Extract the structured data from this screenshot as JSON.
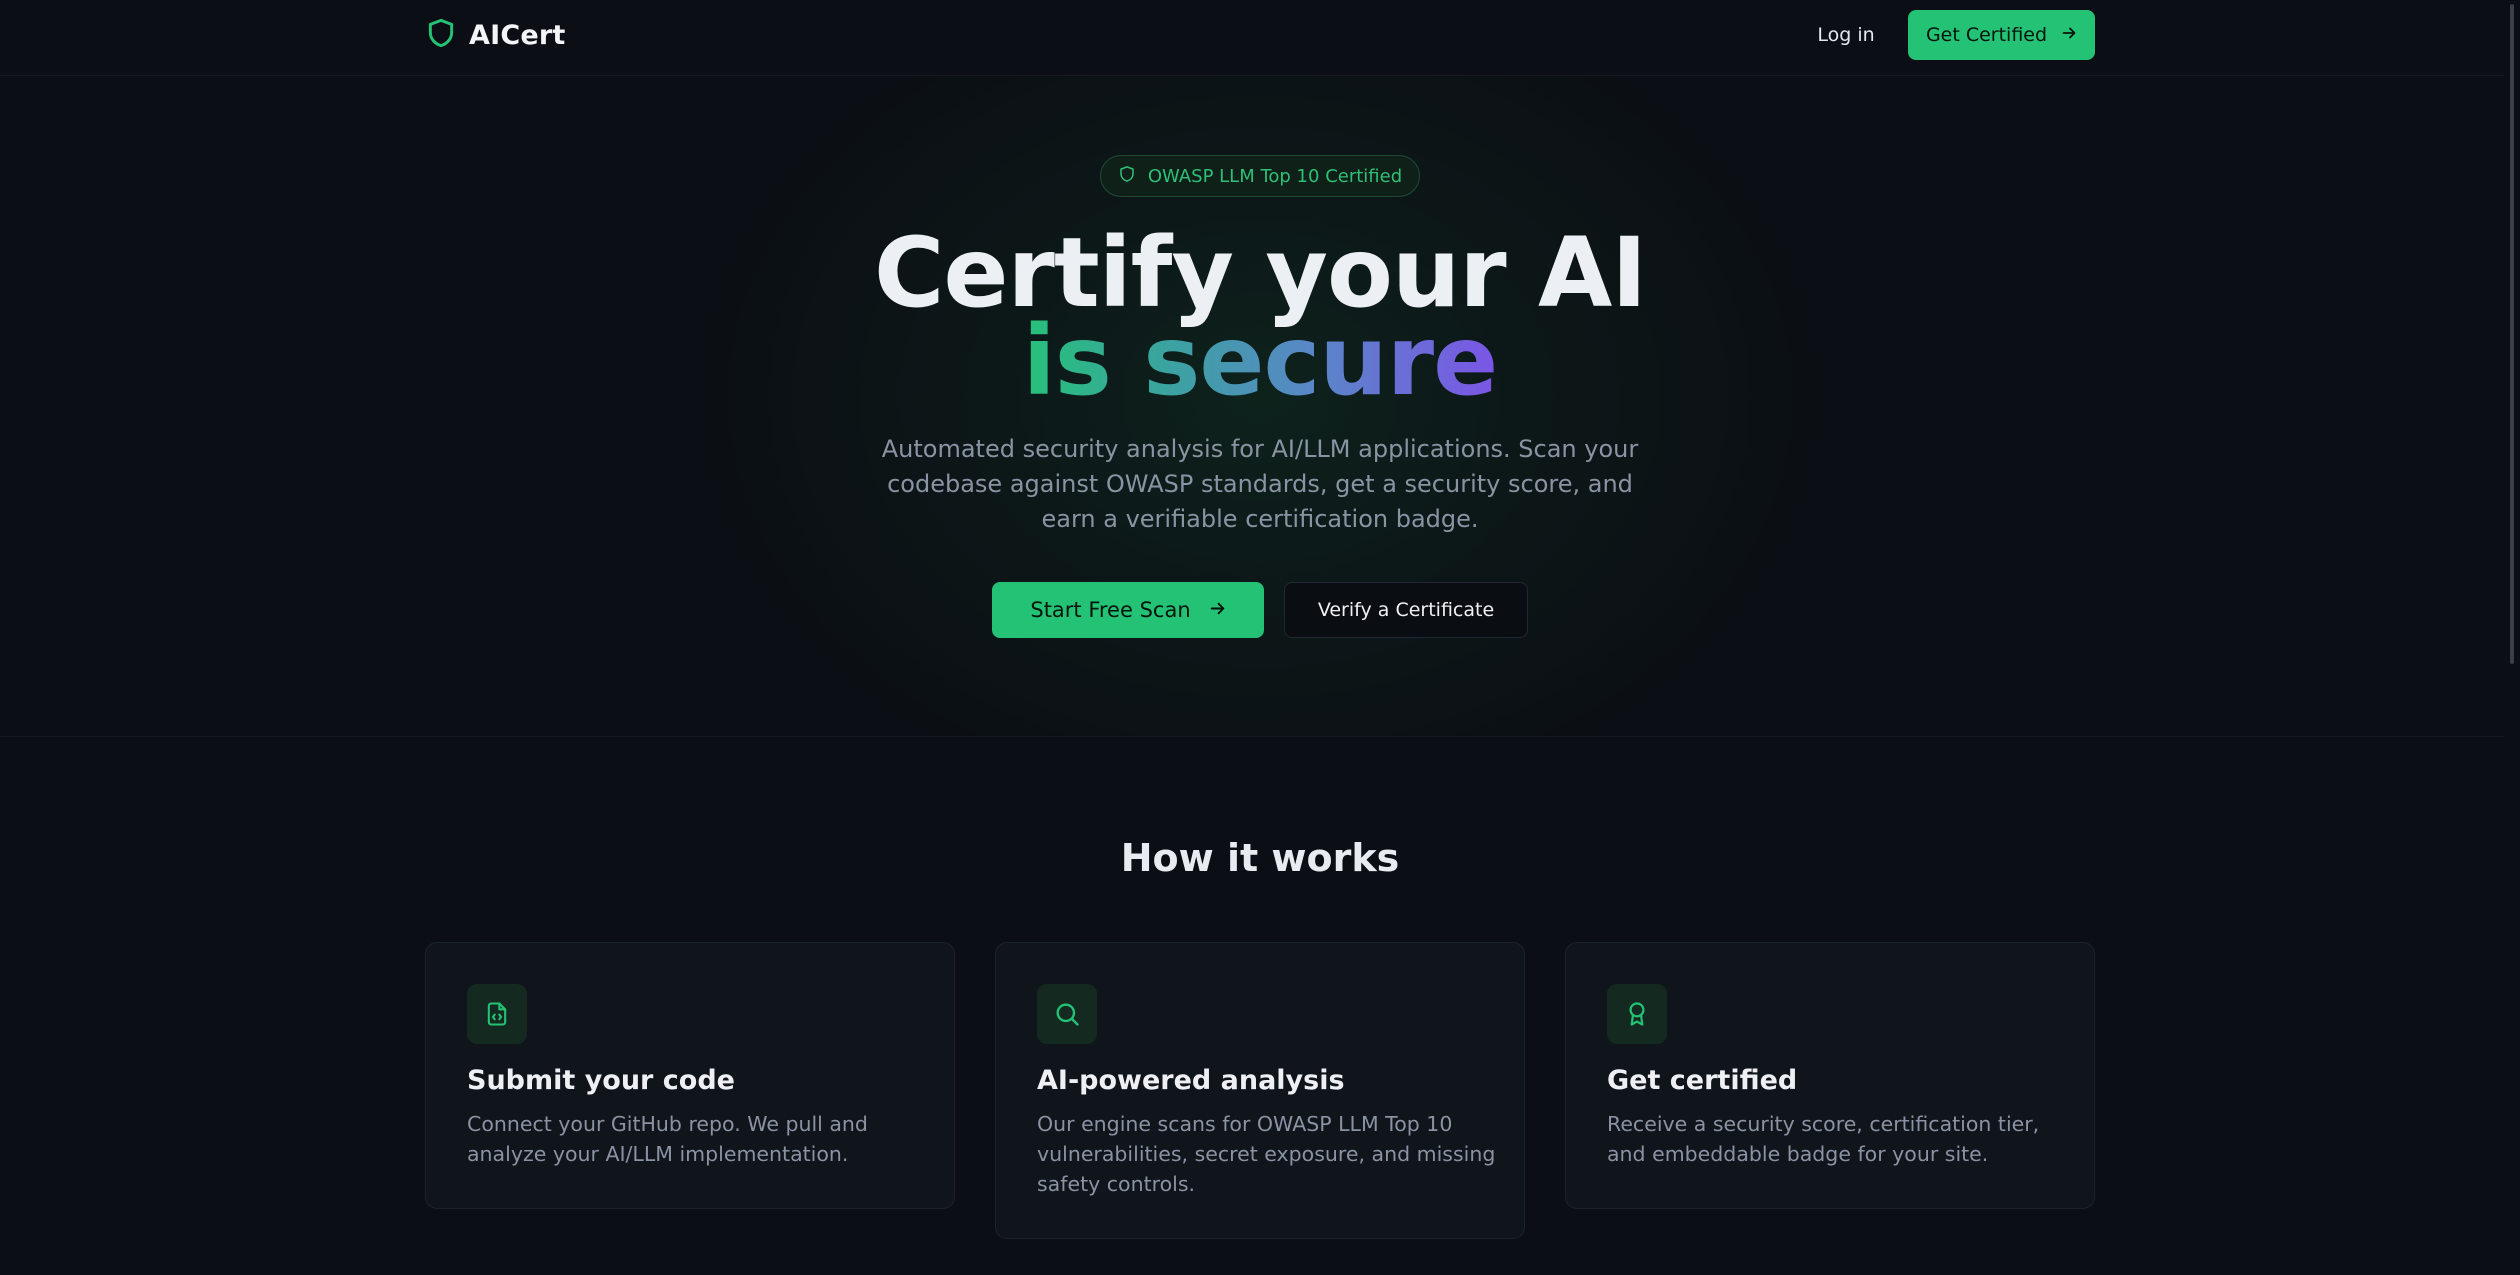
{
  "colors": {
    "background": "#0b0e14",
    "accent": "#23c274",
    "card_background": "#10141b",
    "muted_text": "#8a93a3",
    "gradient": [
      "#27c07a",
      "#5a86c8",
      "#7b55e6"
    ]
  },
  "nav": {
    "logo_icon": "shield-icon",
    "brand": "AICert",
    "login_label": "Log in",
    "cta_label": "Get Certified",
    "cta_icon": "arrow-right-icon"
  },
  "hero": {
    "badge_icon": "shield-icon",
    "badge_text": "OWASP LLM Top 10 Certified",
    "title_line1": "Certify your AI",
    "title_line2": "is secure",
    "subtitle": "Automated security analysis for AI/LLM applications. Scan your codebase against OWASP standards, get a security score, and earn a verifiable certification badge.",
    "primary_label": "Start Free Scan",
    "primary_icon": "arrow-right-icon",
    "secondary_label": "Verify a Certificate"
  },
  "how": {
    "title": "How it works",
    "cards": [
      {
        "icon": "file-code-icon",
        "title": "Submit your code",
        "description": "Connect your GitHub repo. We pull and analyze your AI/LLM implementation."
      },
      {
        "icon": "search-icon",
        "title": "AI-powered analysis",
        "description": "Our engine scans for OWASP LLM Top 10 vulnerabilities, secret exposure, and missing safety controls."
      },
      {
        "icon": "award-icon",
        "title": "Get certified",
        "description": "Receive a security score, certification tier, and embeddable badge for your site."
      }
    ]
  }
}
